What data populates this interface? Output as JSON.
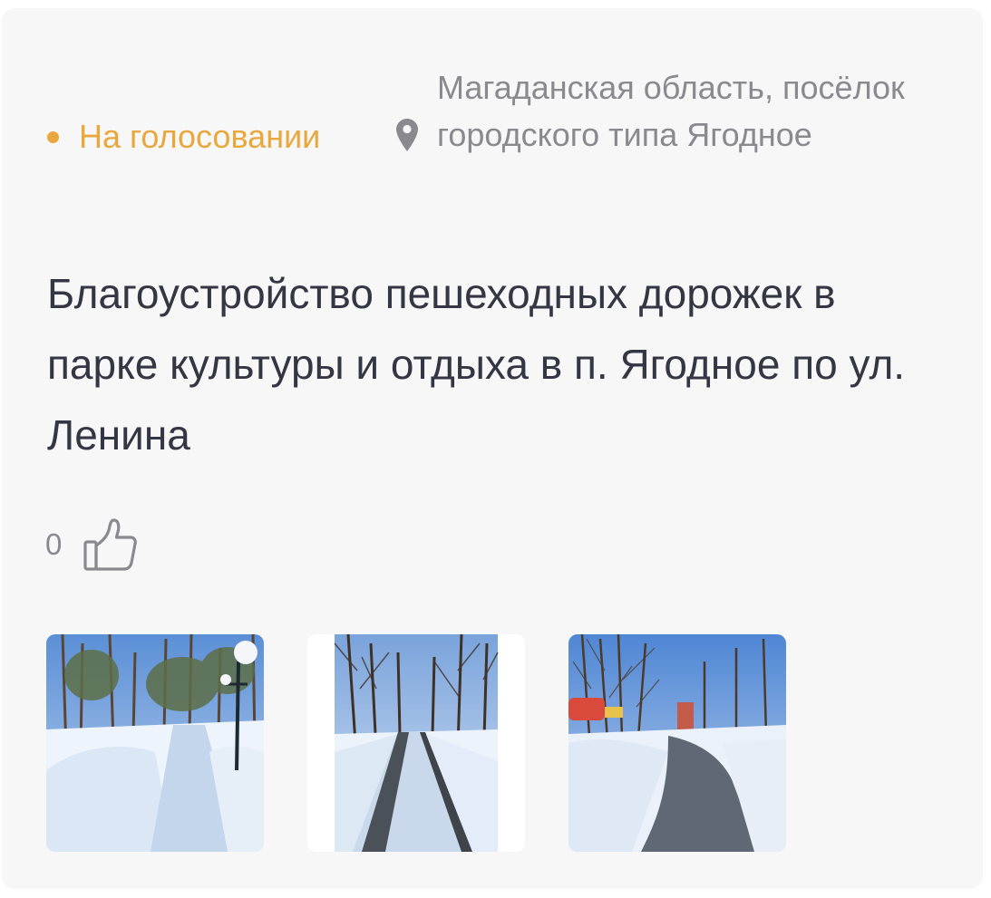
{
  "status": {
    "label": "На голосовании",
    "color": "#e9a83e"
  },
  "location": {
    "icon": "location-pin-icon",
    "text": "Магаданская область, посёлок городского типа Ягодное"
  },
  "title": "Благоустройство пешеходных дорожек в парке культуры и отдыха в п. Ягодное по ул. Ленина",
  "likes": {
    "count": "0",
    "icon": "thumbs-up-icon"
  },
  "photos": [
    {
      "description": "snowy park walkway with street lamp"
    },
    {
      "description": "snow-covered path between bare trees"
    },
    {
      "description": "paved walkway with snowbanks and playground"
    }
  ],
  "colors": {
    "card_background": "#f7f7f8",
    "title_text": "#343643",
    "secondary_text": "#8a8a8e"
  }
}
